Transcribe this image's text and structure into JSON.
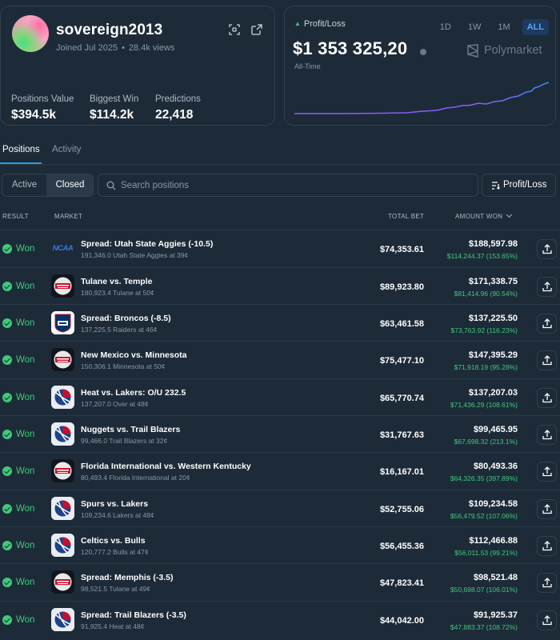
{
  "profile": {
    "username": "sovereign2013",
    "joined": "Joined Jul 2025",
    "views": "28.4k views",
    "stats": [
      {
        "label": "Positions Value",
        "value": "$394.5k"
      },
      {
        "label": "Biggest Win",
        "value": "$114.2k"
      },
      {
        "label": "Predictions",
        "value": "22,418"
      }
    ]
  },
  "pnl": {
    "label": "Profit/Loss",
    "value": "$1 353 325,20",
    "period": "All-Time",
    "brand": "Polymarket",
    "ranges": [
      "1D",
      "1W",
      "1M",
      "ALL"
    ],
    "active_range": "ALL"
  },
  "tabs": {
    "positions": "Positions",
    "activity": "Activity"
  },
  "filters": {
    "active": "Active",
    "closed": "Closed"
  },
  "search": {
    "placeholder": "Search positions"
  },
  "sort": {
    "label": "Profit/Loss"
  },
  "table": {
    "headers": {
      "result": "RESULT",
      "market": "MARKET",
      "total_bet": "TOTAL BET",
      "amount_won": "AMOUNT WON"
    },
    "rows": [
      {
        "result": "Won",
        "logo": "ncaa",
        "logo_text": "NCAA",
        "title": "Spread: Utah State Aggies (-10.5)",
        "sub": "191,346.0 Utah State Aggies at 39¢",
        "total_bet": "$74,353.61",
        "amount_won": "$188,597.98",
        "gain": "$114,244.37 (153.65%)"
      },
      {
        "result": "Won",
        "logo": "cfb",
        "title": "Tulane vs. Temple",
        "sub": "180,923.4 Tulane at 50¢",
        "total_bet": "$89,923.80",
        "amount_won": "$171,338.75",
        "gain": "$81,414.96 (90.54%)"
      },
      {
        "result": "Won",
        "logo": "nfl",
        "title": "Spread: Broncos (-8.5)",
        "sub": "137,225.5 Raiders at 46¢",
        "total_bet": "$63,461.58",
        "amount_won": "$137,225.50",
        "gain": "$73,763.92 (116.23%)"
      },
      {
        "result": "Won",
        "logo": "cfb",
        "title": "New Mexico vs. Minnesota",
        "sub": "150,306.1 Minnesota at 50¢",
        "total_bet": "$75,477.10",
        "amount_won": "$147,395.29",
        "gain": "$71,918.19 (95.28%)"
      },
      {
        "result": "Won",
        "logo": "nba",
        "title": "Heat vs. Lakers: O/U 232.5",
        "sub": "137,207.0 Over at 48¢",
        "total_bet": "$65,770.74",
        "amount_won": "$137,207.03",
        "gain": "$71,436.29 (108.61%)"
      },
      {
        "result": "Won",
        "logo": "nba",
        "title": "Nuggets vs. Trail Blazers",
        "sub": "99,466.0 Trail Blazers at 32¢",
        "total_bet": "$31,767.63",
        "amount_won": "$99,465.95",
        "gain": "$67,698.32 (213.1%)"
      },
      {
        "result": "Won",
        "logo": "cfb",
        "title": "Florida International vs. Western Kentucky",
        "sub": "80,493.4 Florida International at 20¢",
        "total_bet": "$16,167.01",
        "amount_won": "$80,493.36",
        "gain": "$64,326.35 (397.89%)"
      },
      {
        "result": "Won",
        "logo": "nba",
        "title": "Spurs vs. Lakers",
        "sub": "109,234.6 Lakers at 48¢",
        "total_bet": "$52,755.06",
        "amount_won": "$109,234.58",
        "gain": "$56,479.52 (107.06%)"
      },
      {
        "result": "Won",
        "logo": "nba",
        "title": "Celtics vs. Bulls",
        "sub": "120,777.2 Bulls at 47¢",
        "total_bet": "$56,455.36",
        "amount_won": "$112,466.88",
        "gain": "$56,011.53 (99.21%)"
      },
      {
        "result": "Won",
        "logo": "cfb",
        "title": "Spread: Memphis (-3.5)",
        "sub": "98,521.5 Tulane at 49¢",
        "total_bet": "$47,823.41",
        "amount_won": "$98,521.48",
        "gain": "$50,698.07 (106.01%)"
      },
      {
        "result": "Won",
        "logo": "nba",
        "title": "Spread: Trail Blazers (-3.5)",
        "sub": "91,925.4 Heat at 48¢",
        "total_bet": "$44,042.00",
        "amount_won": "$91,925.37",
        "gain": "$47,883.37 (108.72%)"
      }
    ]
  },
  "colors": {
    "background": "#1d2b39",
    "positive": "#3fca7a",
    "accent": "#2d9cdb",
    "chart_line": "#8b5cf6",
    "chart_line_end": "#3b82f6"
  }
}
